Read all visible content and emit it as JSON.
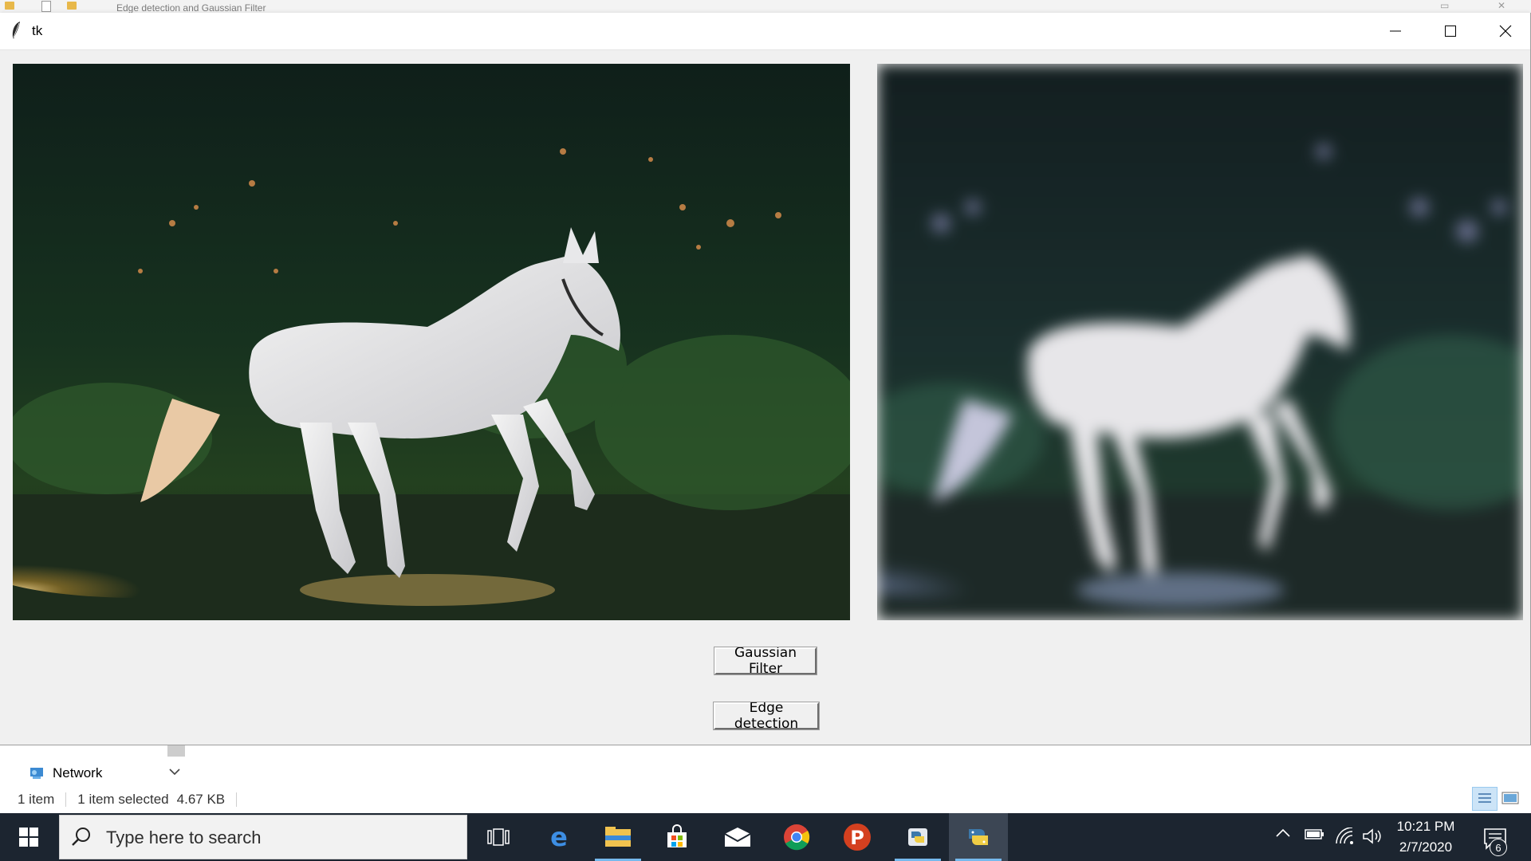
{
  "background_window": {
    "title": "Edge detection and Gaussian Filter",
    "network_label": "Network",
    "status": {
      "item_count": "1 item",
      "selected": "1 item selected",
      "size": "4.67 KB"
    }
  },
  "tk_window": {
    "title": "tk",
    "images": {
      "original": "horse-photo",
      "filtered": "horse-photo-gaussian-blurred"
    },
    "buttons": {
      "gaussian_filter": "Gaussian Filter",
      "edge_detection": "Edge detection"
    }
  },
  "taskbar": {
    "search_placeholder": "Type here to search",
    "apps": [
      "task-view-icon",
      "edge-icon",
      "file-explorer-icon",
      "store-icon",
      "mail-icon",
      "chrome-icon",
      "psiphon-icon",
      "python-idle-icon",
      "python-icon"
    ],
    "clock": {
      "time": "10:21 PM",
      "date": "2/7/2020"
    },
    "notification_count": "6"
  },
  "colors": {
    "taskbar_bg": "#1c2530",
    "window_bg": "#f0f0f0",
    "accent": "#76b9ed"
  }
}
